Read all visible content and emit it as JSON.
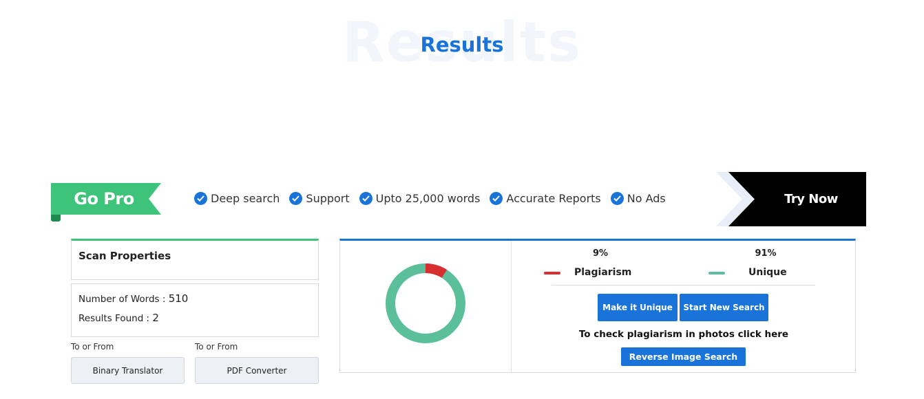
{
  "header": {
    "watermark": "Results",
    "title": "Results"
  },
  "pro_banner": {
    "ribbon_label": "Go Pro",
    "features": [
      {
        "icon": "check-circle-icon",
        "label": "Deep search"
      },
      {
        "icon": "check-circle-icon",
        "label": "Support"
      },
      {
        "icon": "check-circle-icon",
        "label": "Upto 25,000 words"
      },
      {
        "icon": "check-circle-icon",
        "label": "Accurate Reports"
      },
      {
        "icon": "check-circle-icon",
        "label": "No Ads"
      }
    ],
    "cta_label": "Try Now",
    "colors": {
      "ribbon": "#3ec47a",
      "check": "#1a73d9",
      "cta": "#000000"
    }
  },
  "scan_properties": {
    "title": "Scan Properties",
    "words_label": "Number of Words :",
    "words_value": "510",
    "results_label": "Results Found :",
    "results_value": "2"
  },
  "tools": [
    {
      "caption": "To or From",
      "button": "Binary Translator"
    },
    {
      "caption": "To or From",
      "button": "PDF Converter"
    }
  ],
  "results": {
    "plagiarism_percent": 9,
    "unique_percent": 91,
    "plagiarism_pct_label": "9%",
    "unique_pct_label": "91%",
    "plagiarism_label": "Plagiarism",
    "unique_label": "Unique",
    "colors": {
      "plagiarism": "#d83030",
      "unique": "#5cbf9c",
      "accent": "#1a73d9"
    },
    "make_unique_label": "Make it Unique",
    "new_search_label": "Start New Search",
    "photo_note": "To check plagiarism in photos click here",
    "reverse_search_label": "Reverse Image Search"
  }
}
